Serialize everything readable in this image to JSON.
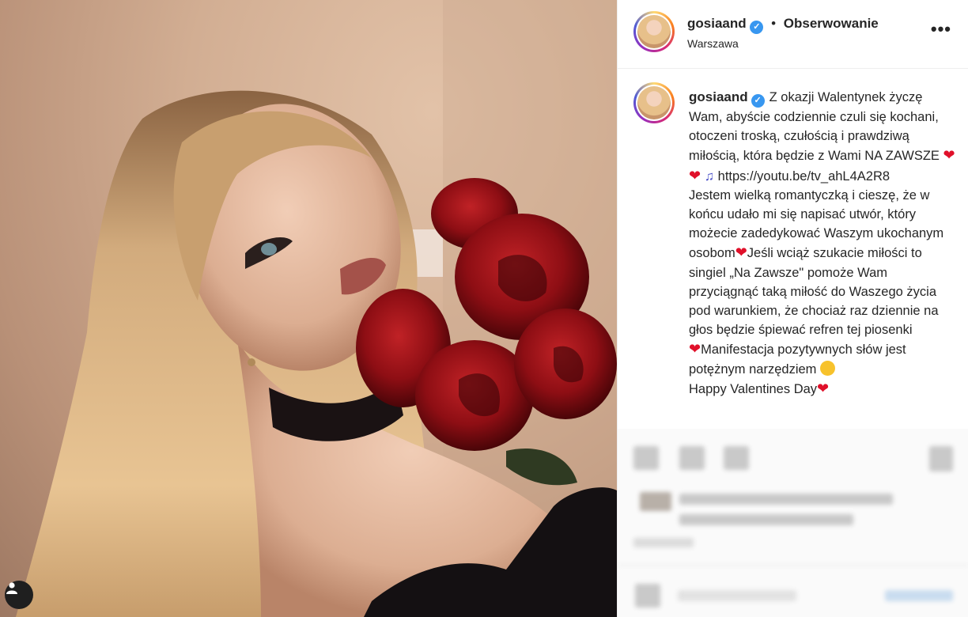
{
  "post": {
    "username": "gosiaand",
    "follow_label": "Obserwowanie",
    "location": "Warszawa",
    "more_icon": "more-horizontal-icon"
  },
  "caption": {
    "username": "gosiaand",
    "line1": "Z okazji Walentynek życzę Wam, abyście codziennie czuli się kochani, otoczeni troską, czułością i prawdziwą miłością, która będzie z Wami NA ZAWSZE",
    "link": "https://youtu.be/tv_ahL4A2R8",
    "line2": "Jestem wielką romantyczką i cieszę, że w końcu udało mi się napisać utwór, który możecie zadedykować Waszym ukochanym osobom",
    "line3": "Jeśli wciąż szukacie miłości to singiel „Na Zawsze\" pomoże Wam przyciągnąć taką miłość do Waszego życia pod warunkiem, że chociaż raz dziennie na głos będzie śpiewać refren tej piosenki",
    "line4": "Manifestacja pozytywnych słów jest potężnym narzędziem",
    "line5": "Happy Valentines Day"
  },
  "colors": {
    "heart": "#e0102a",
    "verified": "#3897f0"
  }
}
